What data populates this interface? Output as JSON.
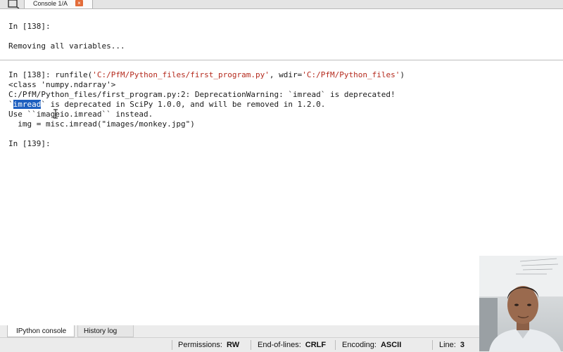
{
  "tabs": {
    "console_tab_label": "Console 1/A",
    "close_glyph": "×"
  },
  "console": {
    "lines": [
      {
        "prefix": "In [",
        "num": "138",
        "suffix": "]:"
      },
      {
        "text": "Removing all variables..."
      },
      {
        "prefix": "In [",
        "num": "138",
        "suffix": "]: runfile(",
        "str1": "'C:/PfM/Python_files/first_program.py'",
        "mid": ", wdir=",
        "str2": "'C:/PfM/Python_files'",
        "end": ")"
      },
      {
        "text": "<class 'numpy.ndarray'>"
      },
      {
        "text": "C:/PfM/Python_files/first_program.py:2: DeprecationWarning: `imread` is deprecated!"
      },
      {
        "tick": "`",
        "selected": "imread",
        "rest": "` is deprecated in SciPy 1.0.0, and will be removed in 1.2.0."
      },
      {
        "text": "Use ``imageio.imread`` instead."
      },
      {
        "text": "  img = misc.imread(\"images/monkey.jpg\")"
      },
      {
        "prefix": "In [",
        "num": "139",
        "suffix": "]:"
      }
    ]
  },
  "pane_tabs": {
    "ipython": "IPython console",
    "history": "History log"
  },
  "status": {
    "permissions_label": "Permissions:",
    "permissions_value": "RW",
    "eol_label": "End-of-lines:",
    "eol_value": "CRLF",
    "encoding_label": "Encoding:",
    "encoding_value": "ASCII",
    "line_label": "Line:",
    "line_value": "3"
  },
  "colors": {
    "selection": "#1d5fbf",
    "string": "#b52a1d",
    "close_button": "#e36c39"
  }
}
